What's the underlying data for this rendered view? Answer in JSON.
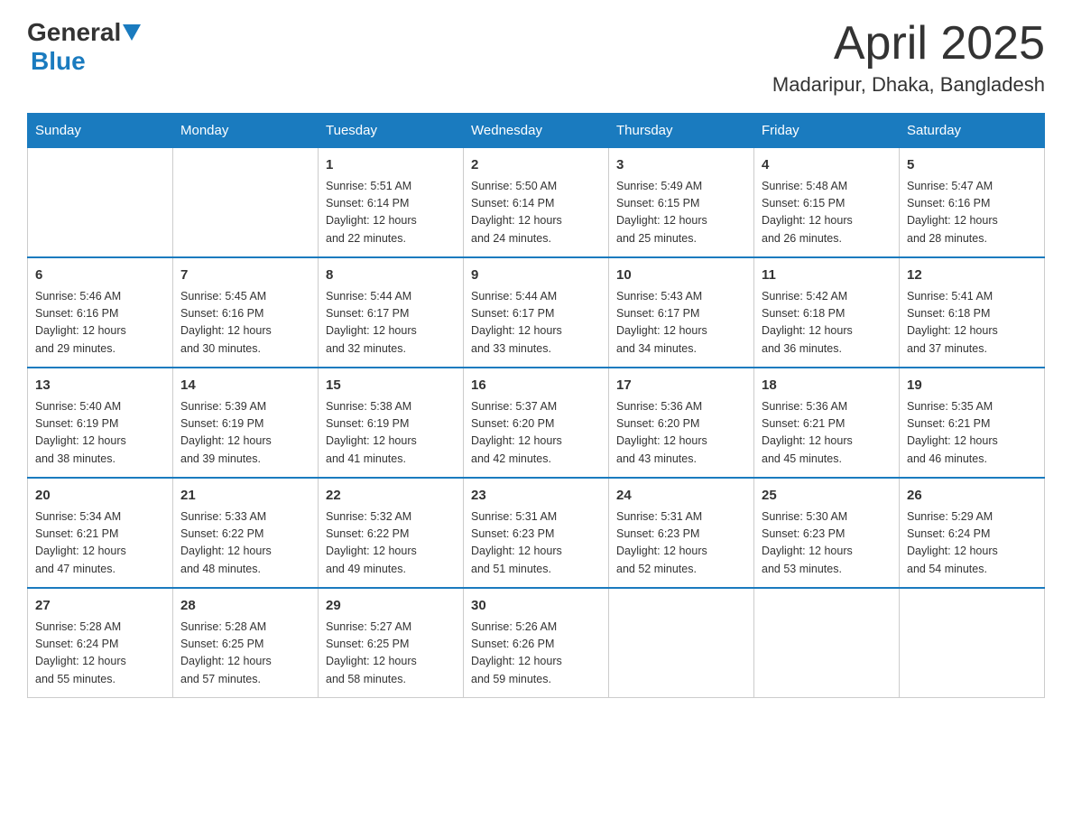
{
  "header": {
    "logo_general": "General",
    "logo_blue": "Blue",
    "month_title": "April 2025",
    "location": "Madaripur, Dhaka, Bangladesh"
  },
  "days_of_week": [
    "Sunday",
    "Monday",
    "Tuesday",
    "Wednesday",
    "Thursday",
    "Friday",
    "Saturday"
  ],
  "weeks": [
    [
      {
        "day": "",
        "info": ""
      },
      {
        "day": "",
        "info": ""
      },
      {
        "day": "1",
        "info": "Sunrise: 5:51 AM\nSunset: 6:14 PM\nDaylight: 12 hours\nand 22 minutes."
      },
      {
        "day": "2",
        "info": "Sunrise: 5:50 AM\nSunset: 6:14 PM\nDaylight: 12 hours\nand 24 minutes."
      },
      {
        "day": "3",
        "info": "Sunrise: 5:49 AM\nSunset: 6:15 PM\nDaylight: 12 hours\nand 25 minutes."
      },
      {
        "day": "4",
        "info": "Sunrise: 5:48 AM\nSunset: 6:15 PM\nDaylight: 12 hours\nand 26 minutes."
      },
      {
        "day": "5",
        "info": "Sunrise: 5:47 AM\nSunset: 6:16 PM\nDaylight: 12 hours\nand 28 minutes."
      }
    ],
    [
      {
        "day": "6",
        "info": "Sunrise: 5:46 AM\nSunset: 6:16 PM\nDaylight: 12 hours\nand 29 minutes."
      },
      {
        "day": "7",
        "info": "Sunrise: 5:45 AM\nSunset: 6:16 PM\nDaylight: 12 hours\nand 30 minutes."
      },
      {
        "day": "8",
        "info": "Sunrise: 5:44 AM\nSunset: 6:17 PM\nDaylight: 12 hours\nand 32 minutes."
      },
      {
        "day": "9",
        "info": "Sunrise: 5:44 AM\nSunset: 6:17 PM\nDaylight: 12 hours\nand 33 minutes."
      },
      {
        "day": "10",
        "info": "Sunrise: 5:43 AM\nSunset: 6:17 PM\nDaylight: 12 hours\nand 34 minutes."
      },
      {
        "day": "11",
        "info": "Sunrise: 5:42 AM\nSunset: 6:18 PM\nDaylight: 12 hours\nand 36 minutes."
      },
      {
        "day": "12",
        "info": "Sunrise: 5:41 AM\nSunset: 6:18 PM\nDaylight: 12 hours\nand 37 minutes."
      }
    ],
    [
      {
        "day": "13",
        "info": "Sunrise: 5:40 AM\nSunset: 6:19 PM\nDaylight: 12 hours\nand 38 minutes."
      },
      {
        "day": "14",
        "info": "Sunrise: 5:39 AM\nSunset: 6:19 PM\nDaylight: 12 hours\nand 39 minutes."
      },
      {
        "day": "15",
        "info": "Sunrise: 5:38 AM\nSunset: 6:19 PM\nDaylight: 12 hours\nand 41 minutes."
      },
      {
        "day": "16",
        "info": "Sunrise: 5:37 AM\nSunset: 6:20 PM\nDaylight: 12 hours\nand 42 minutes."
      },
      {
        "day": "17",
        "info": "Sunrise: 5:36 AM\nSunset: 6:20 PM\nDaylight: 12 hours\nand 43 minutes."
      },
      {
        "day": "18",
        "info": "Sunrise: 5:36 AM\nSunset: 6:21 PM\nDaylight: 12 hours\nand 45 minutes."
      },
      {
        "day": "19",
        "info": "Sunrise: 5:35 AM\nSunset: 6:21 PM\nDaylight: 12 hours\nand 46 minutes."
      }
    ],
    [
      {
        "day": "20",
        "info": "Sunrise: 5:34 AM\nSunset: 6:21 PM\nDaylight: 12 hours\nand 47 minutes."
      },
      {
        "day": "21",
        "info": "Sunrise: 5:33 AM\nSunset: 6:22 PM\nDaylight: 12 hours\nand 48 minutes."
      },
      {
        "day": "22",
        "info": "Sunrise: 5:32 AM\nSunset: 6:22 PM\nDaylight: 12 hours\nand 49 minutes."
      },
      {
        "day": "23",
        "info": "Sunrise: 5:31 AM\nSunset: 6:23 PM\nDaylight: 12 hours\nand 51 minutes."
      },
      {
        "day": "24",
        "info": "Sunrise: 5:31 AM\nSunset: 6:23 PM\nDaylight: 12 hours\nand 52 minutes."
      },
      {
        "day": "25",
        "info": "Sunrise: 5:30 AM\nSunset: 6:23 PM\nDaylight: 12 hours\nand 53 minutes."
      },
      {
        "day": "26",
        "info": "Sunrise: 5:29 AM\nSunset: 6:24 PM\nDaylight: 12 hours\nand 54 minutes."
      }
    ],
    [
      {
        "day": "27",
        "info": "Sunrise: 5:28 AM\nSunset: 6:24 PM\nDaylight: 12 hours\nand 55 minutes."
      },
      {
        "day": "28",
        "info": "Sunrise: 5:28 AM\nSunset: 6:25 PM\nDaylight: 12 hours\nand 57 minutes."
      },
      {
        "day": "29",
        "info": "Sunrise: 5:27 AM\nSunset: 6:25 PM\nDaylight: 12 hours\nand 58 minutes."
      },
      {
        "day": "30",
        "info": "Sunrise: 5:26 AM\nSunset: 6:26 PM\nDaylight: 12 hours\nand 59 minutes."
      },
      {
        "day": "",
        "info": ""
      },
      {
        "day": "",
        "info": ""
      },
      {
        "day": "",
        "info": ""
      }
    ]
  ]
}
